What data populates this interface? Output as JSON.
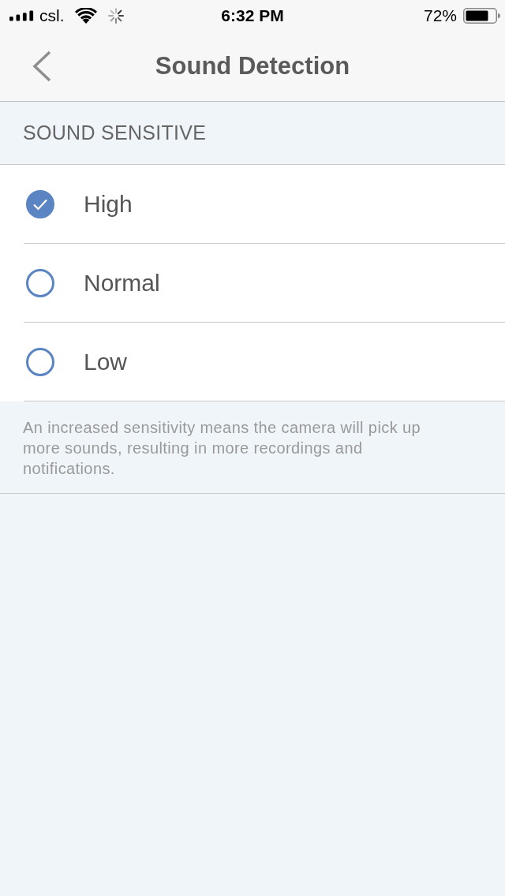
{
  "status_bar": {
    "carrier": "csl.",
    "time": "6:32 PM",
    "battery_percent": "72%"
  },
  "nav": {
    "title": "Sound Detection"
  },
  "section": {
    "header": "SOUND SENSITIVE",
    "options": [
      {
        "label": "High",
        "selected": true
      },
      {
        "label": "Normal",
        "selected": false
      },
      {
        "label": "Low",
        "selected": false
      }
    ],
    "footer": "An increased sensitivity means the camera will pick up more sounds, resulting in more recordings and notifications."
  }
}
